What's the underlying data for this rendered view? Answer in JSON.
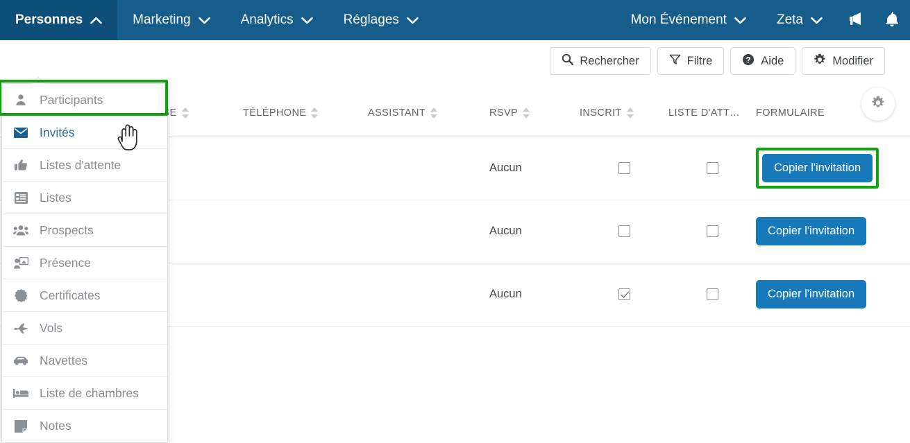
{
  "nav": {
    "left_items": [
      {
        "label": "Personnes",
        "caret": "chevron-up-icon",
        "active": true
      },
      {
        "label": "Marketing",
        "caret": "chevron-down-icon",
        "active": false
      },
      {
        "label": "Analytics",
        "caret": "chevron-down-icon",
        "active": false
      },
      {
        "label": "Réglages",
        "caret": "chevron-down-icon",
        "active": false
      }
    ],
    "right_items": [
      {
        "label": "Mon Événement",
        "caret": "chevron-down-icon"
      },
      {
        "label": "Zeta",
        "caret": "chevron-down-icon"
      }
    ],
    "icons": [
      {
        "name": "megaphone-icon"
      },
      {
        "name": "bell-icon"
      }
    ],
    "bar_color": "#175d8c",
    "active_color": "#0e4f79"
  },
  "menu": {
    "items": [
      {
        "label": "Participants",
        "icon": "person-icon",
        "selected": false
      },
      {
        "label": "Invités",
        "icon": "envelope-icon",
        "selected": true
      },
      {
        "label": "Listes d'attente",
        "icon": "thumbs-up-icon",
        "selected": false
      },
      {
        "label": "Listes",
        "icon": "list-icon",
        "selected": false
      },
      {
        "label": "Prospects",
        "icon": "people-group-icon",
        "selected": false
      },
      {
        "label": "Présence",
        "icon": "presentation-icon",
        "selected": false
      },
      {
        "label": "Certificates",
        "icon": "certificate-badge-icon",
        "selected": false
      },
      {
        "label": "Vols",
        "icon": "airplane-icon",
        "selected": false
      },
      {
        "label": "Navettes",
        "icon": "shuttle-car-icon",
        "selected": false
      },
      {
        "label": "Liste de chambres",
        "icon": "bed-icon",
        "selected": false
      },
      {
        "label": "Notes",
        "icon": "note-icon",
        "selected": false
      }
    ],
    "highlight_color": "#11a211"
  },
  "toolbar": {
    "buttons": [
      {
        "label": "Rechercher",
        "icon": "search-icon"
      },
      {
        "label": "Filtre",
        "icon": "funnel-icon"
      },
      {
        "label": "Aide",
        "icon": "help-circle-icon"
      },
      {
        "label": "Modifier",
        "icon": "gear-icon"
      }
    ],
    "settings_icon": "gear-icon"
  },
  "table": {
    "columns": [
      {
        "label": "ISE",
        "sortable": true,
        "truncated_left": true
      },
      {
        "label": "TÉLÉPHONE",
        "sortable": true
      },
      {
        "label": "ASSISTANT",
        "sortable": true
      },
      {
        "label": "RSVP",
        "sortable": true
      },
      {
        "label": "INSCRIT",
        "sortable": true
      },
      {
        "label": "LISTE D'ATT…",
        "sortable": false
      },
      {
        "label": "FORMULAIRE",
        "sortable": false
      }
    ],
    "rows": [
      {
        "ise": "",
        "telephone": "",
        "assistant": "",
        "rsvp": "Aucun",
        "inscrit": false,
        "liste_attente": false,
        "formulaire_label": "Copier l'invitation",
        "formulaire_highlighted": true
      },
      {
        "ise": "",
        "telephone": "",
        "assistant": "",
        "rsvp": "Aucun",
        "inscrit": false,
        "liste_attente": false,
        "formulaire_label": "Copier l'invitation",
        "formulaire_highlighted": false
      },
      {
        "ise": "",
        "telephone": "",
        "assistant": "",
        "rsvp": "Aucun",
        "inscrit": true,
        "liste_attente": false,
        "formulaire_label": "Copier l'invitation",
        "formulaire_highlighted": false
      }
    ],
    "button_color": "#1779ba"
  }
}
